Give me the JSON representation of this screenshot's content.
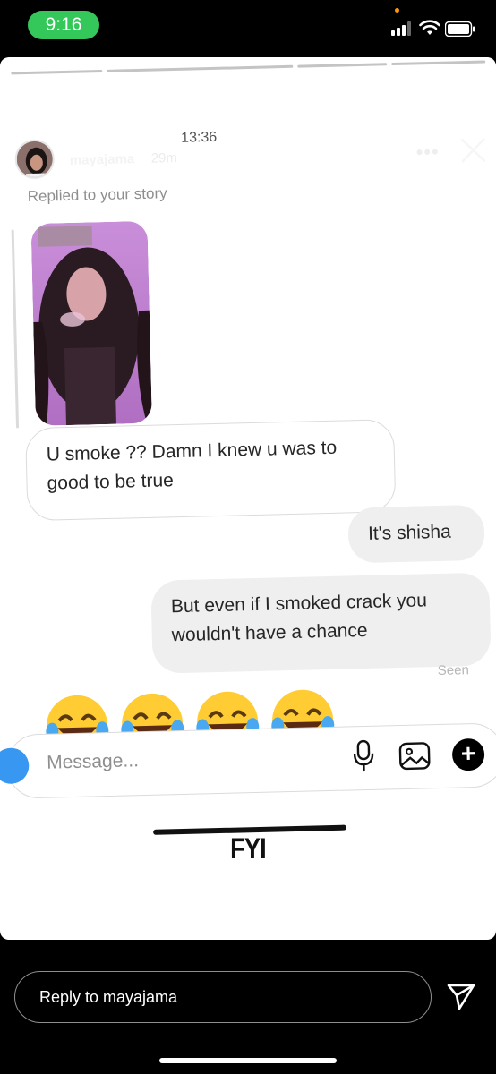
{
  "status_bar": {
    "time": "9:16"
  },
  "screenshot": {
    "clock": "13:36",
    "username": "mayajama",
    "posted_ago": "29m",
    "replied_label": "Replied to your story",
    "messages": [
      {
        "from": "them",
        "text": "U smoke ?? Damn I knew u was to good to be true"
      },
      {
        "from": "me",
        "text": "It's shisha"
      },
      {
        "from": "me",
        "text": "But even if I smoked crack you wouldn't have a chance"
      }
    ],
    "seen_label": "Seen",
    "emoji_reaction": "😂😂😂😂",
    "composer_placeholder": "Message..."
  },
  "caption": "FYI",
  "reply_bar": {
    "placeholder": "Reply to mayajama"
  },
  "colors": {
    "status_pill": "#34c759",
    "bubble_out": "#efefef",
    "camera_button": "#3897f0"
  }
}
